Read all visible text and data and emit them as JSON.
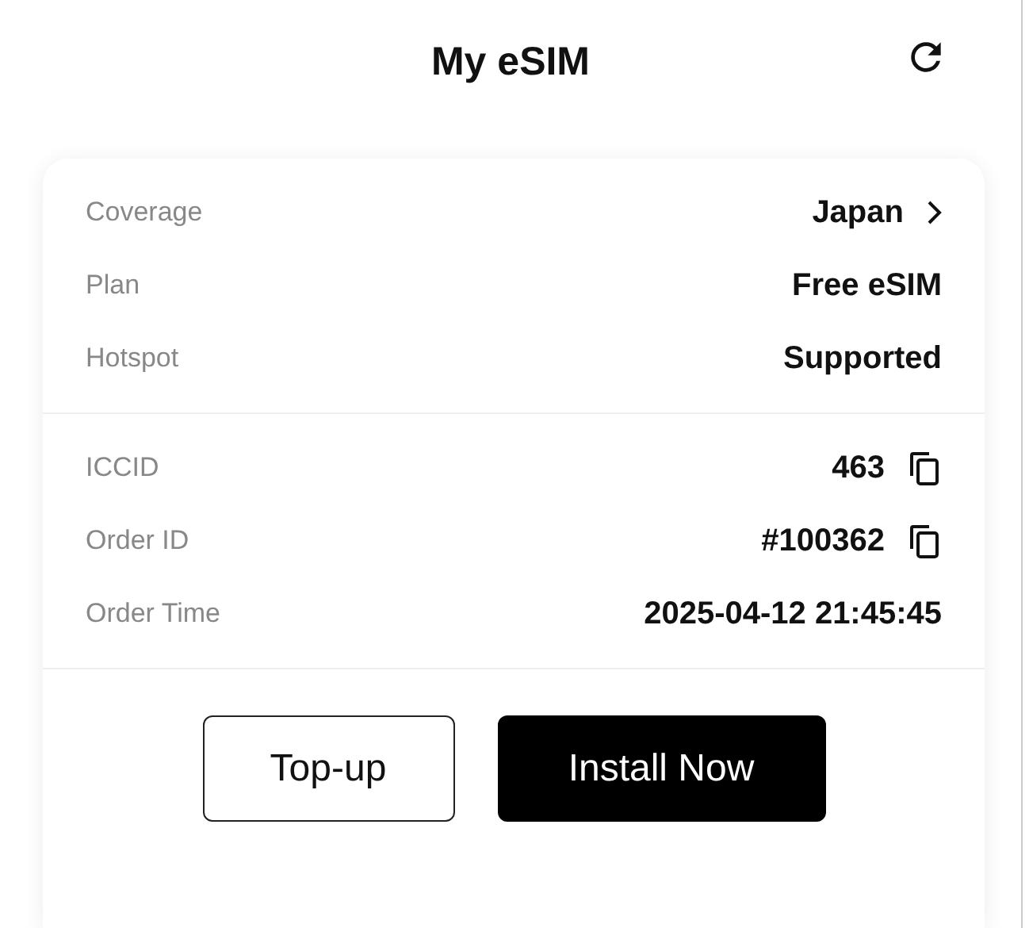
{
  "header": {
    "title": "My eSIM"
  },
  "sections": [
    {
      "rows": [
        {
          "label": "Coverage",
          "value": "Japan",
          "kind": "link"
        },
        {
          "label": "Plan",
          "value": "Free eSIM",
          "kind": "plain"
        },
        {
          "label": "Hotspot",
          "value": "Supported",
          "kind": "plain"
        }
      ]
    },
    {
      "rows": [
        {
          "label": "ICCID",
          "value": "463",
          "kind": "copyable"
        },
        {
          "label": "Order ID",
          "value": "#100362",
          "kind": "copyable"
        },
        {
          "label": "Order Time",
          "value": "2025-04-12 21:45:45",
          "kind": "plain"
        }
      ]
    }
  ],
  "buttons": [
    {
      "label": "Top-up",
      "kind": "outline"
    },
    {
      "label": "Install Now",
      "kind": "primary"
    }
  ]
}
